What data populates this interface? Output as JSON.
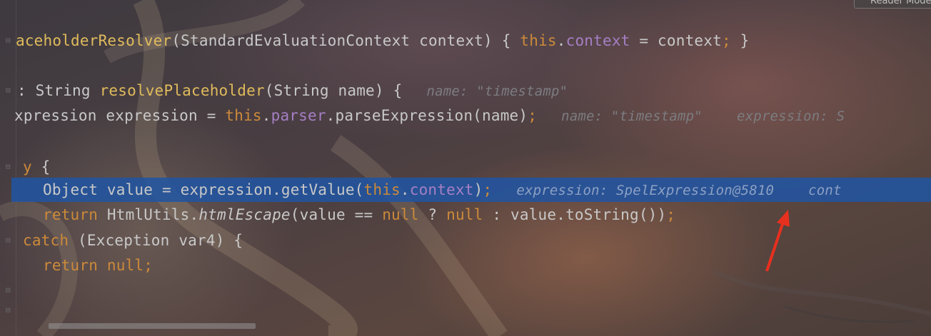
{
  "toolbar": {
    "reader_mode_label": "Reader Mode"
  },
  "lines": {
    "l1": {
      "fn": "aceholderResolver",
      "rest": "(StandardEvaluationContext context) { ",
      "kw": "this",
      "dot": ".",
      "field": "context",
      "assign": " = context",
      "semi": ";",
      "end": " }"
    },
    "l2": {
      "head": ": String ",
      "fn": "resolvePlaceholder",
      "rest": "(String name) {",
      "hint": "name: \"timestamp\""
    },
    "l3": {
      "head": "xpression expression = ",
      "kw": "this",
      "dot": ".",
      "field": "parser",
      "rest": ".parseExpression(name)",
      "semi": ";",
      "hint1": "name: \"timestamp\"",
      "hint2": "expression: S"
    },
    "l4": {
      "kw": "y",
      "rest": " {"
    },
    "l5": {
      "head": "Object value = expression.getValue(",
      "kw": "this",
      "dot": ".",
      "field": "context",
      "rest": ")",
      "semi": ";",
      "hint1": "expression: SpelExpression@5810",
      "hint2": "cont"
    },
    "l6": {
      "kw": "return",
      "mid": " HtmlUtils.",
      "it": "htmlEscape",
      "a": "(value == ",
      "n1": "null",
      "b": " ? ",
      "n2": "null",
      "c": " : value.toString())",
      "semi": ";"
    },
    "l7": {
      "kw": "catch",
      "rest": " (Exception var4) {"
    },
    "l8": {
      "kw": "return",
      "sp": " ",
      "n": "null",
      "semi": ";"
    }
  }
}
